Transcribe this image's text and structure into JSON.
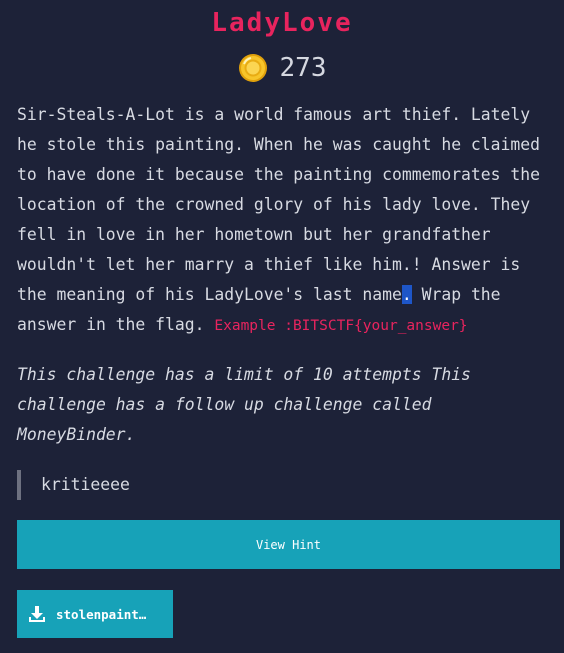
{
  "challenge": {
    "title": "LadyLove",
    "points": "273",
    "points_icon": "coin-icon",
    "description_before_highlight": "Sir-Steals-A-Lot is a world famous art thief. Lately he stole this painting. When he was caught he claimed to have done it because the painting commemorates the location of the crowned glory of his lady love. They fell in love in her hometown but her grandfather wouldn't let her marry a thief like him.! Answer is the meaning of his LadyLove's last name",
    "description_highlight": ".",
    "description_after_highlight": " Wrap the answer in the flag. ",
    "flag_example": "Example :BITSCTF{your_answer}",
    "attempts_note": "This challenge has a limit of 10 attempts This challenge has a follow up challenge called MoneyBinder.",
    "author": "kritieeee"
  },
  "actions": {
    "hint_label": "View Hint",
    "file_label": "stolenpaint…",
    "file_icon": "download-icon"
  },
  "colors": {
    "background": "#1d2238",
    "title": "#e8245e",
    "accent_button": "#17a2b8",
    "highlight": "#1e56c8"
  }
}
